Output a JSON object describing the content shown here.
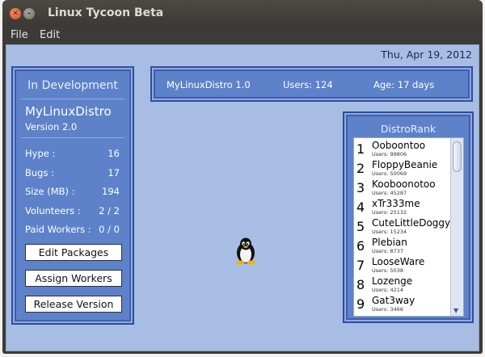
{
  "window": {
    "title": "Linux Tycoon Beta"
  },
  "menu": {
    "file": "File",
    "edit": "Edit"
  },
  "date": "Thu, Apr 19, 2012",
  "dev_panel": {
    "heading": "In Development",
    "distro_name": "MyLinuxDistro",
    "version": "Version 2.0",
    "stats": [
      {
        "label": "Hype :",
        "value": "16"
      },
      {
        "label": "Bugs :",
        "value": "17"
      },
      {
        "label": "Size (MB) :",
        "value": "194"
      },
      {
        "label": "Volunteers :",
        "value": "2 / 2"
      },
      {
        "label": "Paid Workers :",
        "value": "0 / 0"
      }
    ],
    "buttons": {
      "edit_packages": "Edit Packages",
      "assign_workers": "Assign Workers",
      "release_version": "Release Version"
    }
  },
  "status": {
    "release": "MyLinuxDistro 1.0",
    "users": "Users: 124",
    "age": "Age: 17 days"
  },
  "distro_rank": {
    "title": "DistroRank",
    "items": [
      {
        "rank": "1",
        "name": "Ooboontoo",
        "users": "Users: 99806"
      },
      {
        "rank": "2",
        "name": "FloppyBeanie",
        "users": "Users: 50069"
      },
      {
        "rank": "3",
        "name": "Kooboonotoo",
        "users": "Users: 45287"
      },
      {
        "rank": "4",
        "name": "xTr333me",
        "users": "Users: 25132"
      },
      {
        "rank": "5",
        "name": "CuteLittleDoggy",
        "users": "Users: 15234"
      },
      {
        "rank": "6",
        "name": "Plebian",
        "users": "Users: 8737"
      },
      {
        "rank": "7",
        "name": "LooseWare",
        "users": "Users: 5038"
      },
      {
        "rank": "8",
        "name": "Lozenge",
        "users": "Users: 4214"
      },
      {
        "rank": "9",
        "name": "Gat3way",
        "users": "Users: 3466"
      }
    ]
  },
  "icons": {
    "close": "close-icon",
    "minimize": "minimize-icon",
    "mascot": "penguin-icon"
  }
}
